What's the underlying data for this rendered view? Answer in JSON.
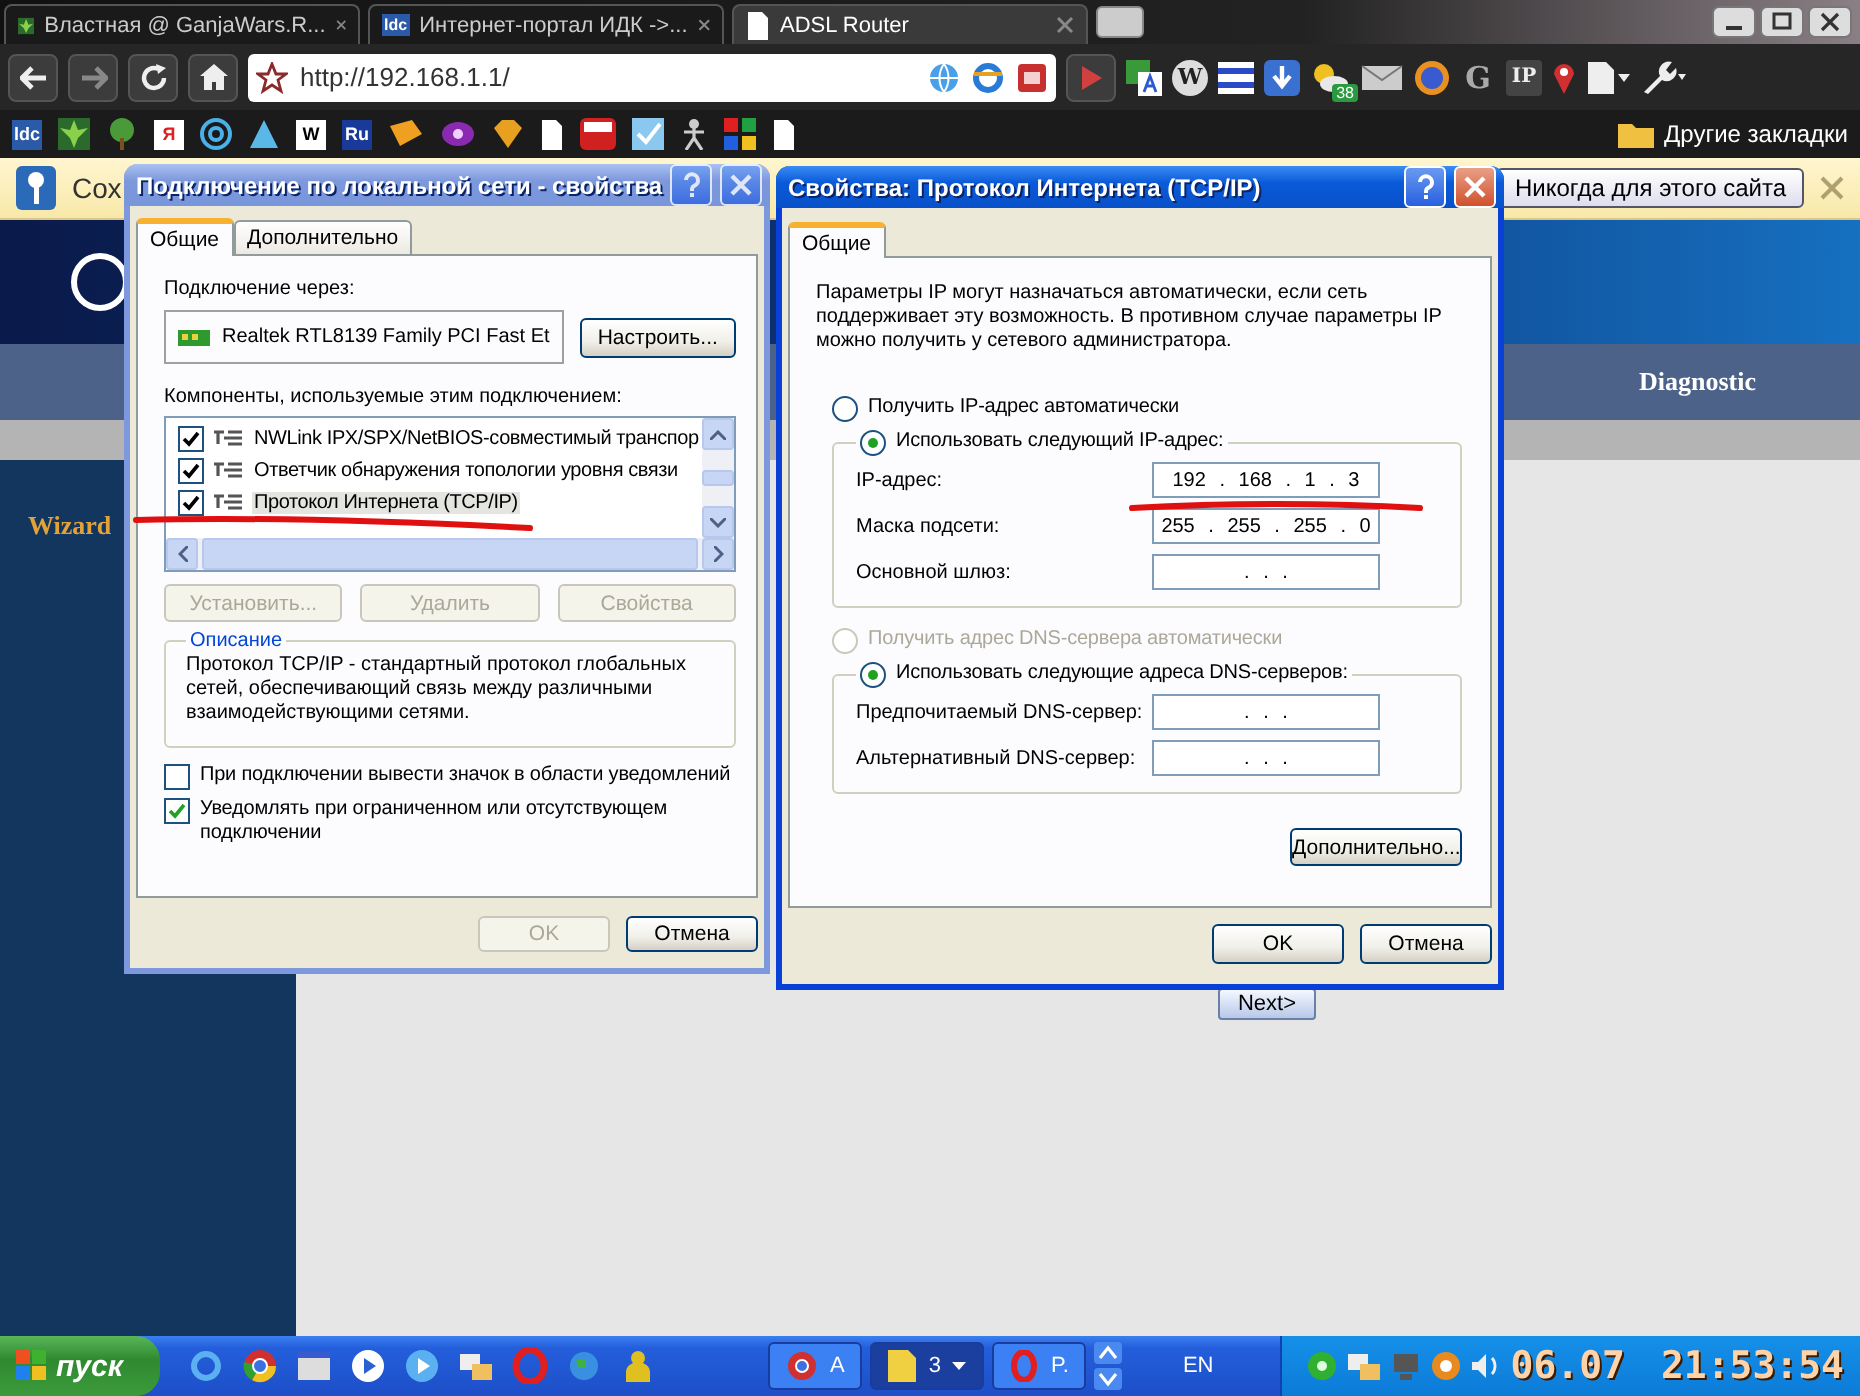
{
  "browser": {
    "tabs": [
      {
        "title": "Властная @ GanjaWars.R...",
        "selected": false
      },
      {
        "title": "Интернет-портал ИДК ->...",
        "selected": false,
        "favicon_label": "ldc"
      },
      {
        "title": "ADSL Router",
        "selected": true
      }
    ],
    "address": "http://192.168.1.1/",
    "extension_labels": [
      "W",
      "38",
      "G",
      "IP"
    ],
    "bookmark_labels": [
      "ldc",
      "Я",
      "W",
      "Ru"
    ],
    "other_bookmarks": "Другие закладки"
  },
  "infobar": {
    "text": "Сох",
    "button": "Никогда для этого сайта"
  },
  "router_page": {
    "nav": "Diagnostic",
    "sidebar": "Wizard",
    "next_button": "Next>"
  },
  "lan_dialog": {
    "title": "Подключение по локальной сети - свойства",
    "active": false,
    "tabs": [
      {
        "label": "Общие",
        "selected": true
      },
      {
        "label": "Дополнительно",
        "selected": false
      }
    ],
    "connect_via_label": "Подключение через:",
    "adapter": "Realtek RTL8139 Family PCI Fast Et",
    "configure_button": "Настроить...",
    "components_label": "Компоненты, используемые этим подключением:",
    "components": [
      {
        "name": "NWLink IPX/SPX/NetBIOS-совместимый транспор",
        "checked": true,
        "selected": false
      },
      {
        "name": "Ответчик обнаружения топологии уровня связи",
        "checked": true,
        "selected": false
      },
      {
        "name": "Протокол Интернета (TCP/IP)",
        "checked": true,
        "selected": true
      }
    ],
    "component_buttons": [
      {
        "label": "Установить...",
        "disabled": true
      },
      {
        "label": "Удалить",
        "disabled": true
      },
      {
        "label": "Свойства",
        "disabled": true
      }
    ],
    "description_title": "Описание",
    "description": "Протокол TCP/IP - стандартный протокол глобальных сетей, обеспечивающий связь между различными взаимодействующими сетями.",
    "options": [
      {
        "label": "При подключении вывести значок в области уведомлений",
        "checked": false
      },
      {
        "label": "Уведомлять при ограниченном или отсутствующем подключении",
        "checked": true
      }
    ],
    "buttons": [
      {
        "label": "OK",
        "disabled": true
      },
      {
        "label": "Отмена",
        "disabled": false
      }
    ]
  },
  "tcpip_dialog": {
    "title": "Свойства: Протокол Интернета (TCP/IP)",
    "active": true,
    "tabs": [
      {
        "label": "Общие",
        "selected": true
      }
    ],
    "intro": "Параметры IP могут назначаться автоматически, если сеть поддерживает эту возможность. В противном случае параметры IP можно получить у сетевого администратора.",
    "ip_mode": [
      {
        "label": "Получить IP-адрес автоматически",
        "selected": false,
        "disabled": false
      },
      {
        "label": "Использовать следующий IP-адрес:",
        "selected": true,
        "disabled": false
      }
    ],
    "ip_fields": [
      {
        "label": "IP-адрес:",
        "value": "192 . 168 . 1 . 3"
      },
      {
        "label": "Маска подсети:",
        "value": "255 . 255 . 255 . 0"
      },
      {
        "label": "Основной шлюз:",
        "value": ". . ."
      }
    ],
    "dns_mode": [
      {
        "label": "Получить адрес DNS-сервера автоматически",
        "selected": false,
        "disabled": true
      },
      {
        "label": "Использовать следующие адреса DNS-серверов:",
        "selected": true,
        "disabled": false
      }
    ],
    "dns_fields": [
      {
        "label": "Предпочитаемый DNS-сервер:",
        "value": ". . ."
      },
      {
        "label": "Альтернативный DNS-сервер:",
        "value": ". . ."
      }
    ],
    "advanced_button": "Дополнительно...",
    "buttons": [
      {
        "label": "OK",
        "disabled": false
      },
      {
        "label": "Отмена",
        "disabled": false
      }
    ]
  },
  "taskbar": {
    "start": "пуск",
    "tasks": [
      {
        "label": "A",
        "selected": false
      },
      {
        "label": "3",
        "selected": true
      },
      {
        "label": "P.",
        "selected": false
      }
    ],
    "language": "EN",
    "date": "06.07",
    "time": "21:53:54"
  }
}
